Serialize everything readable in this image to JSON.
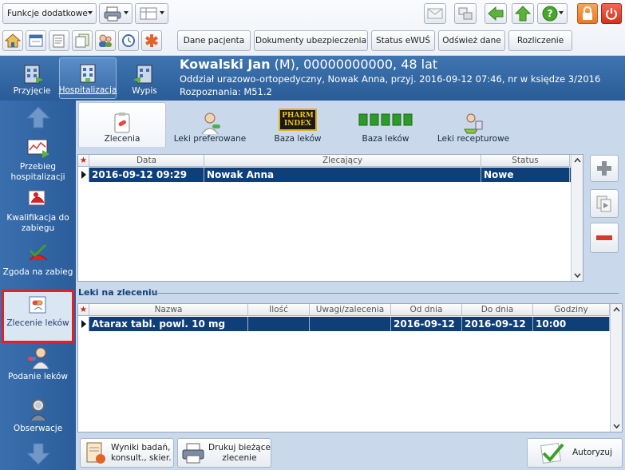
{
  "toolbar": {
    "extra_functions": "Funkcje dodatkowe",
    "buttons": [
      "Dane pacjenta",
      "Dokumenty ubezpieczenia",
      "Status eWUŚ",
      "Odśwież dane",
      "Rozliczenie"
    ]
  },
  "nav": {
    "admission": "Przyjęcie",
    "hospitalization": "Hospitalizacja",
    "discharge": "Wypis"
  },
  "patient": {
    "name": "Kowalski Jan",
    "details": " (M), 00000000000, 48 lat",
    "ward": "Oddział urazowo-ortopedyczny, Nowak Anna, przyj. 2016-09-12 07:46, nr w księdze 3/2016",
    "diagnosis": "Rozpoznania: M51.2"
  },
  "sidebar": {
    "items": [
      {
        "label": "Przebieg hospitalizacji"
      },
      {
        "label": "Kwalifikacja do zabiegu"
      },
      {
        "label": "Zgoda na zabieg"
      },
      {
        "label": "Zlecenie leków"
      },
      {
        "label": "Podanie leków"
      },
      {
        "label": "Obserwacje"
      }
    ]
  },
  "tabs": [
    {
      "label": "Zlecenia"
    },
    {
      "label": "Leki preferowane"
    },
    {
      "label": "Baza leków"
    },
    {
      "label": "Baza leków"
    },
    {
      "label": "Leki recepturowe"
    }
  ],
  "tab_logos": {
    "pharmindex_top": "PHARM",
    "pharmindex_bottom": "INDEX"
  },
  "orders_table": {
    "columns": [
      "Data",
      "Zlecający",
      "Status"
    ],
    "rows": [
      {
        "date": "2016-09-12 09:29",
        "ordered_by": "Nowak Anna",
        "status": "Nowe"
      }
    ]
  },
  "drugs_section": {
    "title": "Leki na zleceniu",
    "columns": [
      "Nazwa",
      "Ilość",
      "Uwagi/zalecenia",
      "Od dnia",
      "Do dnia",
      "Godziny"
    ],
    "rows": [
      {
        "name": "Atarax tabl. powl. 10 mg",
        "qty": "",
        "notes": "",
        "from": "2016-09-12",
        "to": "2016-09-12",
        "hours": "10:00"
      }
    ]
  },
  "bottom": {
    "results": "Wyniki badań,\nkonsult., skier.",
    "print": "Drukuj bieżące\nzlecenie",
    "authorize": "Autoryzuj"
  },
  "colors": {
    "header": "#2f639f",
    "selected_row": "#0f3f78",
    "highlight": "#e0202a"
  }
}
